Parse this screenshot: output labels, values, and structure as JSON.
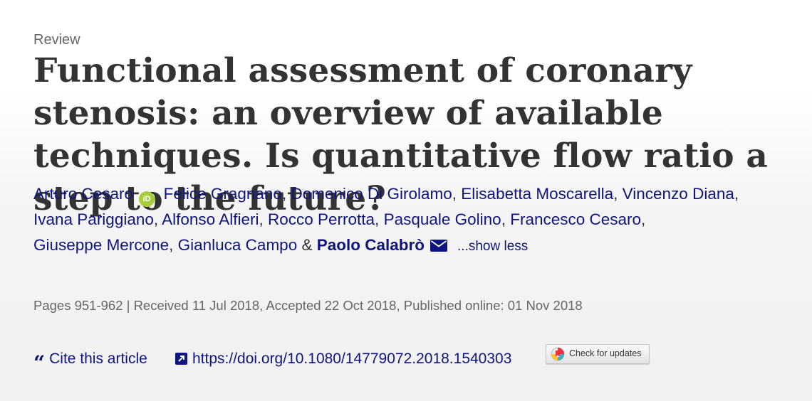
{
  "article": {
    "type": "Review",
    "title": "Functional assessment of coronary stenosis: an overview of available techniques. Is quantitative flow ratio a step to the future?",
    "authors": [
      "Arturo Cesaro",
      "Felice Gragnano",
      "Domenico Di Girolamo",
      "Elisabetta Moscarella",
      "Vincenzo Diana",
      "Ivana Pariggiano",
      "Alfonso Alfieri",
      "Rocco Perrotta",
      "Pasquale Golino",
      "Francesco Cesaro",
      "Giuseppe Mercone",
      "Gianluca Campo",
      "Paolo Calabrò"
    ],
    "orcid_badge": "iD",
    "author_separator": ", ",
    "author_last_separator": " & ",
    "show_less_label": "...show less",
    "meta": "Pages 951-962 | Received 11 Jul 2018, Accepted 22 Oct 2018, Published online: 01 Nov 2018"
  },
  "actions": {
    "cite_label": "Cite this article",
    "doi_url": "https://doi.org/10.1080/14779072.2018.1540303",
    "check_updates_label": "Check for updates"
  },
  "icons": {
    "orcid": "orcid-icon",
    "email": "envelope-icon",
    "cite": "quote-icon",
    "doi": "external-link-icon",
    "check_updates": "crossmark-icon"
  },
  "colors": {
    "link": "#10147e",
    "text": "#333333",
    "muted": "#666666",
    "orcid": "#a6ce39"
  }
}
